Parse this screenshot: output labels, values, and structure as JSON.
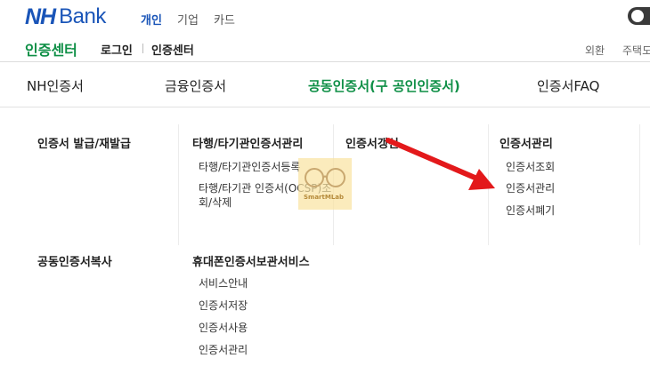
{
  "header": {
    "logo_nh": "NH",
    "logo_bank": "Bank",
    "tabs": [
      {
        "label": "개인",
        "active": true
      },
      {
        "label": "기업",
        "active": false
      },
      {
        "label": "카드",
        "active": false
      }
    ]
  },
  "subheader": {
    "title": "인증센터",
    "links": [
      "로그인",
      "인증센터"
    ],
    "utilities": [
      "외환",
      "주택도"
    ]
  },
  "gnb": {
    "items": [
      {
        "label": "NH인증서",
        "active": false
      },
      {
        "label": "금융인증서",
        "active": false
      },
      {
        "label": "공동인증서(구 공인인증서)",
        "active": true
      },
      {
        "label": "인증서FAQ",
        "active": false
      }
    ]
  },
  "menu": {
    "col1": {
      "categories": [
        "인증서 발급/재발급",
        "공동인증서복사"
      ]
    },
    "col2": {
      "cat1": "타행/타기관인증서관리",
      "cat1_items": [
        "타행/타기관인증서등록",
        "타행/타기관 인증서(OCSP)조",
        "회/삭제"
      ],
      "cat2": "휴대폰인증서보관서비스",
      "cat2_items": [
        "서비스안내",
        "인증서저장",
        "인증서사용",
        "인증서관리"
      ]
    },
    "col3": {
      "cat1": "인증서갱신"
    },
    "col4": {
      "cat1": "인증서관리",
      "cat1_items": [
        "인증서조회",
        "인증서관리",
        "인증서폐기"
      ]
    }
  },
  "watermark": {
    "text": "SmartMLab"
  },
  "colors": {
    "brand_blue": "#1a55b8",
    "brand_green": "#0e8f46",
    "arrow_red": "#e3191b"
  }
}
